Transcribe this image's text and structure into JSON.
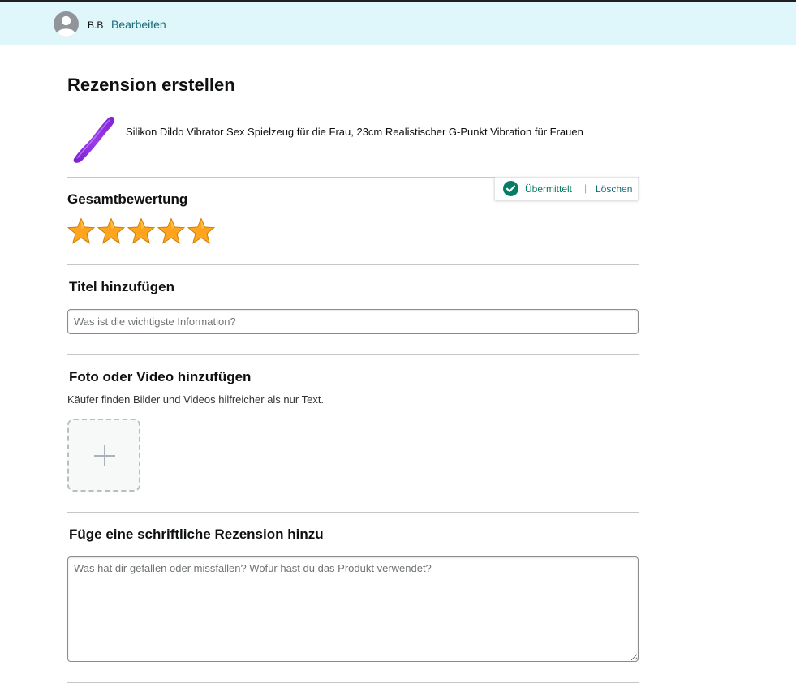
{
  "header": {
    "avatar_icon": "user-silhouette-icon",
    "username": "B.B",
    "edit_link": "Bearbeiten"
  },
  "page": {
    "title": "Rezension erstellen"
  },
  "product": {
    "title": "Silikon Dildo Vibrator Sex Spielzeug für die Frau, 23cm Realistischer G-Punkt Vibration für Frauen",
    "image_icon": "purple-product-image",
    "image_color": "#8e2bd8"
  },
  "status": {
    "icon": "check-circle-icon",
    "submitted_label": "Übermittelt",
    "separator": "|",
    "delete_label": "Löschen",
    "color": "#067d62"
  },
  "rating": {
    "heading": "Gesamtbewertung",
    "value": 5,
    "max": 5,
    "star_color": "#ffa41c"
  },
  "title_section": {
    "heading": "Titel hinzufügen",
    "placeholder": "Was ist die wichtigste Information?",
    "value": ""
  },
  "media_section": {
    "heading": "Foto oder Video hinzufügen",
    "hint": "Käufer finden Bilder und Videos hilfreicher als nur Text.",
    "upload_icon": "plus-icon"
  },
  "review_section": {
    "heading": "Füge eine schriftliche Rezension hinzu",
    "placeholder": "Was hat dir gefallen oder missfallen? Wofür hast du das Produkt verwendet?",
    "value": ""
  },
  "colors": {
    "header_bg": "#dff6fb",
    "link": "#1a6b78"
  }
}
